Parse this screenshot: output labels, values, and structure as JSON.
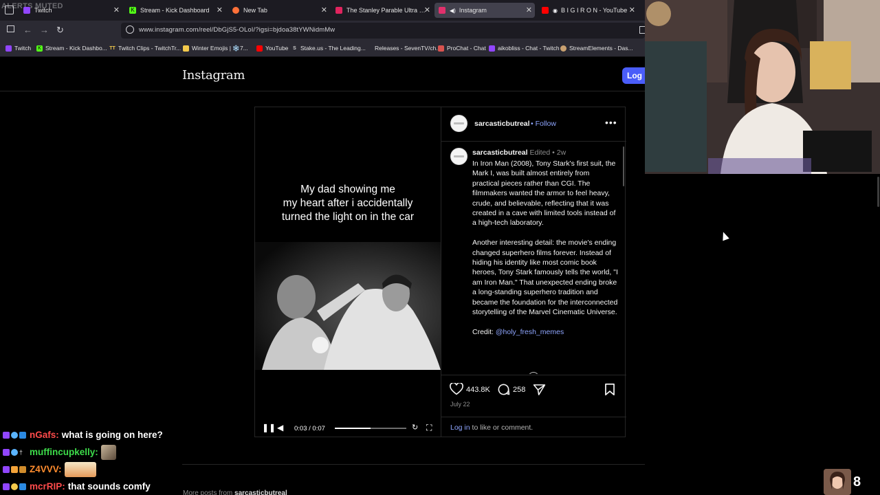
{
  "alerts_label": "ALERTS MUTED",
  "tabs": [
    {
      "title": "Twitch",
      "favicon_color": "#9146ff",
      "active": false
    },
    {
      "title": "Stream - Kick Dashboard",
      "favicon_color": "#53fc18",
      "active": false
    },
    {
      "title": "New Tab",
      "favicon_color": "#ff7139",
      "active": false
    },
    {
      "title": "The Stanley Parable Ultra Delux",
      "favicon_color": "#e0245e",
      "active": false
    },
    {
      "title": "Instagram",
      "favicon_color": "#e1306c",
      "active": true
    },
    {
      "title": "B I G I R O N - YouTube",
      "favicon_color": "#ff0000",
      "active": false
    }
  ],
  "url": "www.instagram.com/reel/DbGjS5-OLoI/?igsi=bjdoa38tYWNidmMw",
  "bookmarks": [
    {
      "label": "Twitch",
      "icon_color": "#9146ff"
    },
    {
      "label": "Stream - Kick Dashbo...",
      "icon_color": "#53fc18"
    },
    {
      "label": "Twitch Clips - TwitchTr...",
      "icon_color": "#f2c94c"
    },
    {
      "label": "Winter Emojis | ❄️7...",
      "icon_color": "#f2c94c"
    },
    {
      "label": "YouTube",
      "icon_color": "#ff0000"
    },
    {
      "label": "Stake.us - The Leading...",
      "icon_color": "#cccccc"
    },
    {
      "label": "Releases - SevenTV/ch...",
      "icon_color": "#2b2a33"
    },
    {
      "label": "ProChat - Chat",
      "icon_color": "#d9534f"
    },
    {
      "label": "aikobliss - Chat - Twitch",
      "icon_color": "#9146ff"
    },
    {
      "label": "StreamElements - Das...",
      "icon_color": "#c8a070"
    }
  ],
  "instagram": {
    "logo": "Instagram",
    "login_button": "Log",
    "video": {
      "caption_lines": [
        "My dad showing me",
        "my heart after i accidentally",
        "turned the light on in the car"
      ],
      "time": "0:03 / 0:07",
      "progress": 0.5
    },
    "post": {
      "username": "sarcasticbutreal",
      "follow": "• Follow",
      "edited": "Edited",
      "age": "2w",
      "paragraph1": "In Iron Man (2008), Tony Stark's first suit, the Mark I, was built almost entirely from practical pieces rather than CGI. The filmmakers wanted the armor to feel heavy, crude, and believable, reflecting that it was created in a cave with limited tools instead of a high-tech laboratory.",
      "paragraph2": "Another interesting detail: the movie's ending changed superhero films forever. Instead of hiding his identity like most comic book heroes, Tony Stark famously tells the world, \"I am Iron Man.\" That unexpected ending broke a long-standing superhero tradition and became the foundation for the interconnected storytelling of the Marvel Cinematic Universe.",
      "credit_label": "Credit:",
      "credit_handle": "@holy_fresh_memes",
      "likes": "443.8K",
      "comments": "258",
      "date": "July 22",
      "login_link": "Log in",
      "login_suffix": "to like or comment."
    },
    "more_posts_prefix": "More posts from",
    "more_posts_user": "sarcasticbutreal"
  },
  "chat": [
    {
      "user": "nGafs:",
      "color": "#ff4b4b",
      "message": "what is going on here?",
      "emote": false
    },
    {
      "user": "muffincupkelly:",
      "color": "#3ddc4a",
      "message": "",
      "emote": true
    },
    {
      "user": "Z4VVV:",
      "color": "#ff8c2e",
      "message": "",
      "emote": true
    },
    {
      "user": "mcrRIP:",
      "color": "#ff4b4b",
      "message": "that sounds comfy",
      "emote": false
    }
  ],
  "viewer_count": "8"
}
